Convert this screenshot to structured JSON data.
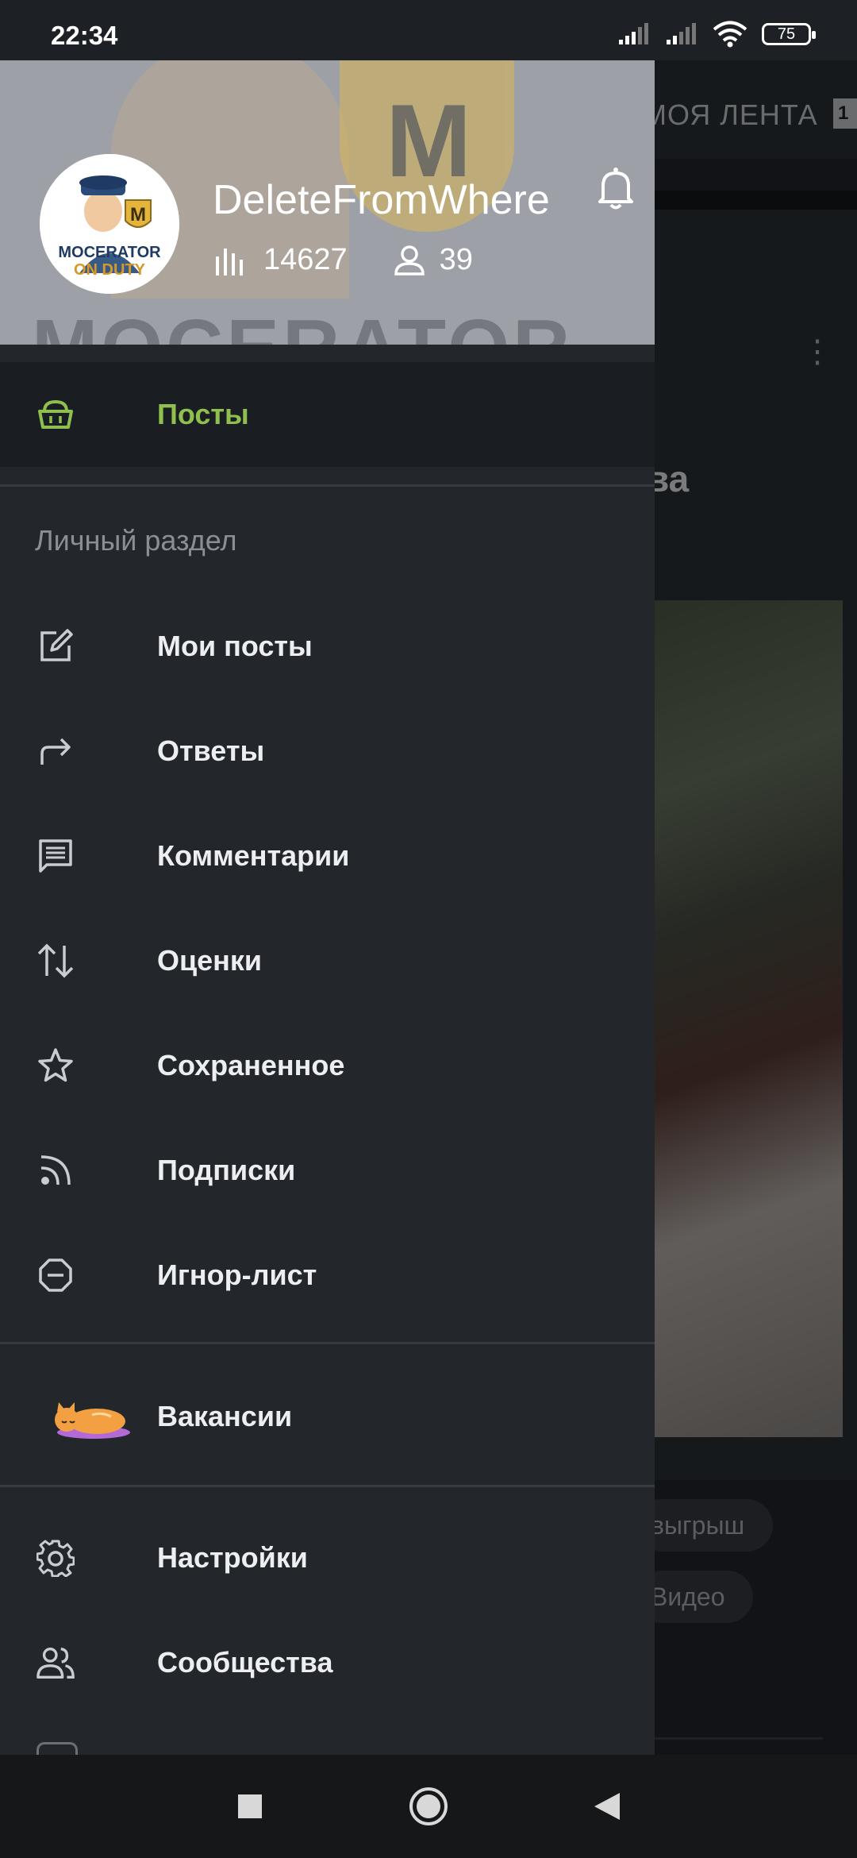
{
  "status_bar": {
    "time": "22:34",
    "battery": "75",
    "icons": [
      "signal-icon",
      "signal-icon",
      "wifi-icon",
      "battery-icon"
    ]
  },
  "background": {
    "feed_tab": "МОЯ ЛЕНТА",
    "feed_count": "1",
    "post_title_fragment": "ва",
    "tags": [
      "выгрыш",
      "Видео"
    ]
  },
  "drawer": {
    "username": "DeleteFromWhere",
    "rating": "14627",
    "subscribers": "39",
    "avatar_line1": "MOCERATOR",
    "avatar_line2": "ON DUTY",
    "avatar_badge": "M",
    "active_item": {
      "label": "Посты",
      "icon": "basket-icon",
      "accent": "#8fc04f"
    },
    "section_title": "Личный раздел",
    "personal_items": [
      {
        "label": "Мои посты",
        "icon": "edit-square-icon"
      },
      {
        "label": "Ответы",
        "icon": "reply-arrow-icon"
      },
      {
        "label": "Комментарии",
        "icon": "comment-icon"
      },
      {
        "label": "Оценки",
        "icon": "up-down-arrows-icon"
      },
      {
        "label": "Сохраненное",
        "icon": "star-icon"
      },
      {
        "label": "Подписки",
        "icon": "rss-icon"
      },
      {
        "label": "Игнор-лист",
        "icon": "block-icon"
      }
    ],
    "jobs_item": {
      "label": "Вакансии",
      "icon": "cat-icon"
    },
    "bottom_items": [
      {
        "label": "Настройки",
        "icon": "gear-icon"
      },
      {
        "label": "Сообщества",
        "icon": "people-icon"
      }
    ]
  },
  "nav_bar": {
    "buttons": [
      "recents-icon",
      "home-icon",
      "back-icon"
    ]
  }
}
